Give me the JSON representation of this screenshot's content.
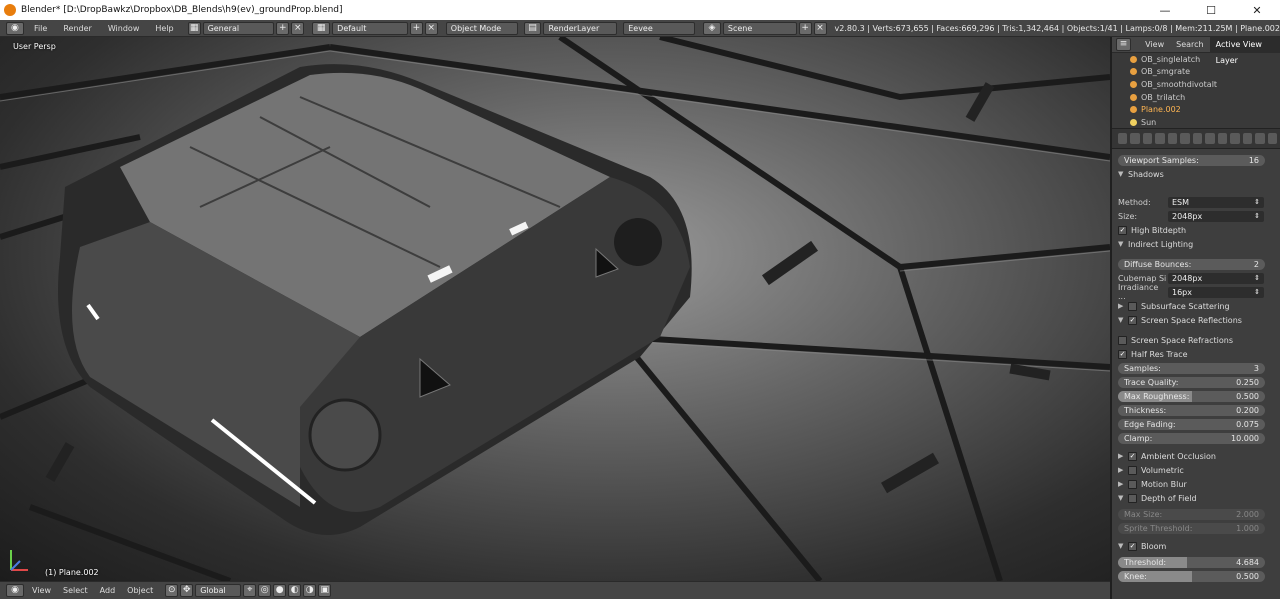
{
  "titlebar": {
    "title": "Blender* [D:\\DropBawkz\\Dropbox\\DB_Blends\\h9(ev)_groundProp.blend]",
    "minimize": "—",
    "maximize": "☐",
    "close": "✕"
  },
  "topbar": {
    "menus": [
      "File",
      "Render",
      "Window",
      "Help"
    ],
    "workspace": "General",
    "screen": "Default",
    "mode": "Object Mode",
    "render_layer": "RenderLayer",
    "engine": "Eevee",
    "scene": "Scene",
    "stats": "v2.80.3 | Verts:673,655 | Faces:669,296 | Tris:1,342,464 | Objects:1/41 | Lamps:0/8 | Mem:211.25M | Plane.002"
  },
  "viewport": {
    "view_label": "User Persp",
    "object_label": "(1) Plane.002"
  },
  "bottombar": {
    "menus": [
      "View",
      "Select",
      "Add",
      "Object"
    ],
    "orientation": "Global"
  },
  "outliner": {
    "tabs": [
      "View",
      "Search",
      "Active View Layer"
    ],
    "items": [
      {
        "name": "OB_singlelatch"
      },
      {
        "name": "OB_smgrate"
      },
      {
        "name": "OB_smoothdivotalt"
      },
      {
        "name": "OB_trilatch"
      },
      {
        "name": "Plane.002"
      },
      {
        "name": "Sun"
      }
    ]
  },
  "properties": {
    "viewport_samples": {
      "label": "Viewport Samples:",
      "value": "16"
    },
    "shadows": {
      "title": "Shadows",
      "method_label": "Method:",
      "method": "ESM",
      "size_label": "Size:",
      "size": "2048px",
      "high_bitdepth": "High Bitdepth"
    },
    "indirect": {
      "title": "Indirect Lighting",
      "diffuse_label": "Diffuse Bounces:",
      "diffuse": "2",
      "cubemap_label": "Cubemap Si",
      "cubemap": "2048px",
      "irradiance_label": "Irradiance ...",
      "irradiance": "16px"
    },
    "sss": {
      "title": "Subsurface Scattering"
    },
    "ssr": {
      "title": "Screen Space Reflections",
      "refractions": "Screen Space Refractions",
      "half_res": "Half Res Trace",
      "fields": [
        {
          "label": "Samples:",
          "value": "3",
          "frac": 0
        },
        {
          "label": "Trace Quality:",
          "value": "0.250",
          "frac": 0
        },
        {
          "label": "Max Roughness:",
          "value": "0.500",
          "frac": 0.5
        },
        {
          "label": "Thickness:",
          "value": "0.200",
          "frac": 0
        },
        {
          "label": "Edge Fading:",
          "value": "0.075",
          "frac": 0
        },
        {
          "label": "Clamp:",
          "value": "10.000",
          "frac": 0
        }
      ]
    },
    "ao": {
      "title": "Ambient Occlusion"
    },
    "volumetric": {
      "title": "Volumetric"
    },
    "motion_blur": {
      "title": "Motion Blur"
    },
    "dof": {
      "title": "Depth of Field",
      "max_size_label": "Max Size:",
      "max_size": "2.000",
      "sprite_label": "Sprite Threshold:",
      "sprite": "1.000"
    },
    "bloom": {
      "title": "Bloom",
      "threshold_label": "Threshold:",
      "threshold": "4.684",
      "threshold_frac": 0.47,
      "knee_label": "Knee:",
      "knee": "0.500",
      "knee_frac": 0.5
    }
  }
}
